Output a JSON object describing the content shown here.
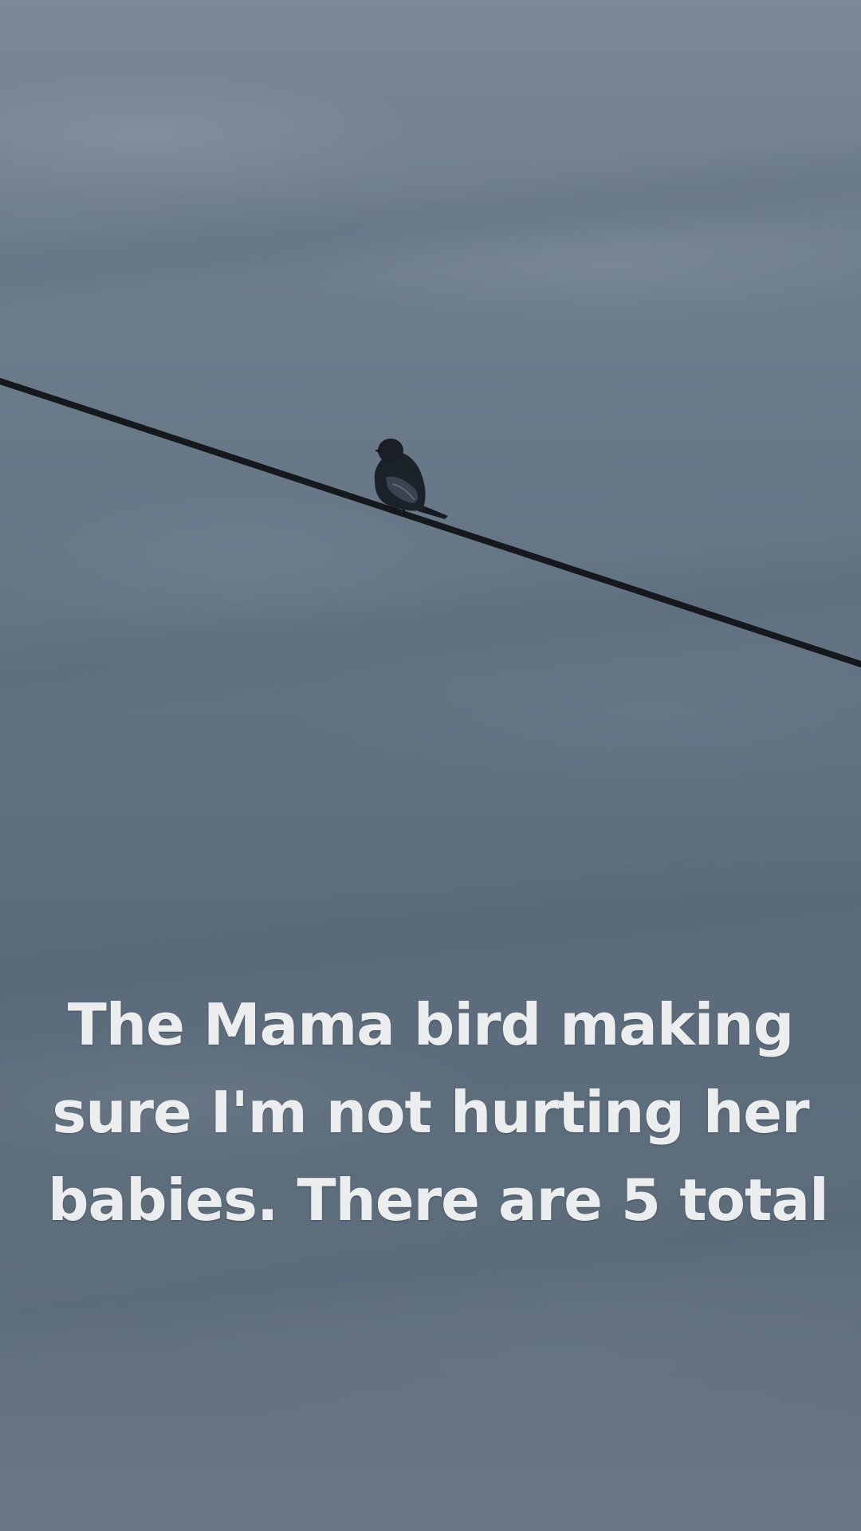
{
  "caption": {
    "lines": [
      "The Mama bird making",
      "sure I'm not hurting her",
      "babies. There are 5 total"
    ]
  },
  "colors": {
    "sky": "#647484",
    "wire": "#15191e",
    "bird": "#1c222a",
    "caption_text": "#ecedee"
  },
  "scene": {
    "subject": "bird-on-wire"
  }
}
